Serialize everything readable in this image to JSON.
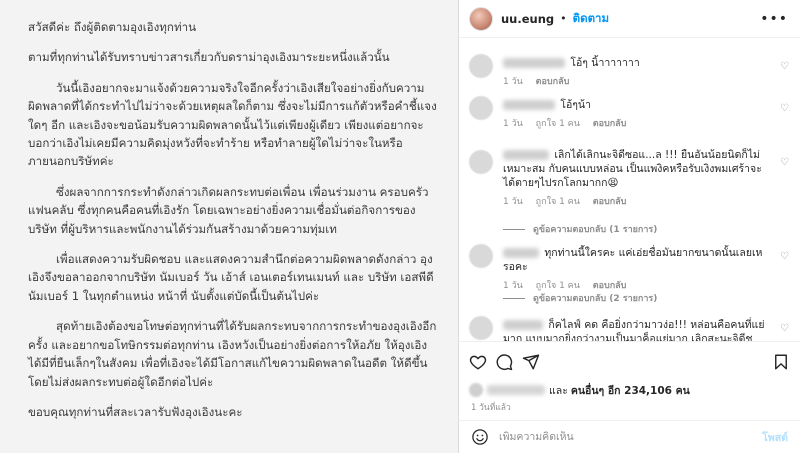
{
  "letter": {
    "greeting": "สวัสดีค่ะ ถึงผู้ติดตามอุงเอิงทุกท่าน",
    "intro": "ตามที่ทุกท่านได้รับทราบข่าวสารเกี่ยวกับดราม่าอุงเอิงมาระยะหนึ่งแล้วนั้น",
    "para1": "วันนี้เอิงอยากจะมาแจ้งด้วยความจริงใจอีกครั้งว่าเอิงเสียใจอย่างยิ่งกับความผิดพลาดที่ได้กระทำไปไม่ว่าจะด้วยเหตุผลใดก็ตาม ซึ่งจะไม่มีการแก้ตัวหรือคำชี้แจงใดๆ อีก และเอิงจะขอน้อมรับความผิดพลาดนั้นไว้แต่เพียงผู้เดียว เพียงแต่อยากจะบอกว่าเอิงไม่เคยมีความคิดมุ่งหวังที่จะทำร้าย หรือทำลายผู้ใดไม่ว่าจะในหรือภายนอกบริษัทค่ะ",
    "para2": "ซึ่งผลจากการกระทำดังกล่าวเกิดผลกระทบต่อเพื่อน เพื่อนร่วมงาน ครอบครัว แฟนคลับ ซึ่งทุกคนคือคนที่เอิงรัก โดยเฉพาะอย่างยิ่งความเชื่อมั่นต่อกิจการของบริษัท ที่ผู้บริหารและพนักงานได้ร่วมกันสร้างมาด้วยความทุ่มเท",
    "para3": "เพื่อแสดงความรับผิดชอบ และแสดงความสำนึกต่อความผิดพลาดดังกล่าว อุงเอิงจึงขอลาออกจากบริษัท นัมเบอร์ วัน เอ้าส์ เอนเตอร์เทนเมนท์ และ บริษัท เอสพีดี นัมเบอร์ 1 ในทุกตำแหน่ง หน้าที่ นับตั้งแต่บัดนี้เป็นต้นไปค่ะ",
    "para4": "สุดท้ายเอิงต้องขอโทษต่อทุกท่านที่ได้รับผลกระทบจากการกระทำของอุงเอิงอีกครั้ง และอยากขอโทษิกรรมต่อทุกท่าน เอิงหวังเป็นอย่างยิ่งต่อการให้อภัย ให้อุงเอิงได้มีที่ยืนเล็กๆในสังคม เพื่อที่เอิงจะได้มีโอกาสแก้ไขความผิดพลาดในอดีต ให้ดีขึ้นโดยไม่ส่งผลกระทบต่อผู้ใดอีกต่อไปค่ะ",
    "closing": "ขอบคุณทุกท่านที่สละเวลารับฟังอุงเอิงนะคะ"
  },
  "header": {
    "username": "uu.eung",
    "separator": "•",
    "follow_label": "ติดตาม",
    "more_icon": "•••"
  },
  "comments": [
    {
      "text": "โอ้ๆ นิ้าาาาาาา",
      "time": "1 วัน",
      "likes": "",
      "reply": "ตอบกลับ"
    },
    {
      "text": "โอ้ๆน้า",
      "time": "1 วัน",
      "likes": "ถูกใจ 1 คน",
      "reply": "ตอบกลับ"
    },
    {
      "text": "เลิกได้เลิกนะจิดีซอแ...ล !!! ยืนอันน้อยนิดก็ไม่เหมาะสม กับคนแบบหล่อน เป็นแพงิคหรือรับเงิงพมเศร้าจะได้ตายๆไปรกโลกมากก😫",
      "time": "1 วัน",
      "likes": "ถูกใจ 1 คน",
      "reply": "ตอบกลับ",
      "view_replies": "ดูข้อความตอบกลับ (1 รายการ)"
    },
    {
      "text": "ทุกท่านนี้ใครคะ แค่เอ่ยชื่อมันยากขนาดนั้นเลยเหรอคะ",
      "time": "1 วัน",
      "likes": "ถูกใจ 1 คน",
      "reply": "ตอบกลับ",
      "view_replies": "ดูข้อความตอบกลับ (2 รายการ)"
    },
    {
      "text": "ก็คไลฟ์ คด คือยิ่งกว่ามาวง่อ!!! หล่อนคือคนที่แย่มาก แบบมากยิ่งกว่างามเป็นมาค็อแย่มาก เลิกสะนะจิดีชเหมือนตัวเองเป็นผู้ถูก"
    }
  ],
  "likes": {
    "and_label": "และ",
    "others_label": "คนอื่นๆ อีก 234,106 คน"
  },
  "timestamp": "1 วันที่แล้ว",
  "composer": {
    "placeholder": "เพิ่มความคิดเห็น",
    "post_label": "โพสต์"
  },
  "colors": {
    "accent": "#0095f6",
    "post_disabled": "#b2dffc",
    "muted": "#8e8e8e",
    "letter_bg": "#f3f3f3"
  },
  "icons": [
    "heart-icon",
    "comment-icon",
    "share-icon",
    "bookmark-icon",
    "emoji-icon",
    "more-icon"
  ]
}
